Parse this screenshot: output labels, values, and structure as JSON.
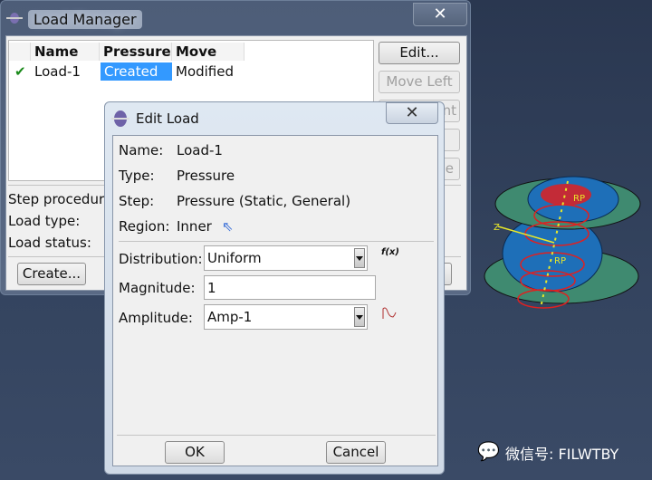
{
  "load_manager": {
    "title": "Load Manager",
    "columns": [
      "Name",
      "Pressure",
      "Move"
    ],
    "rows": [
      {
        "status": "check-icon",
        "name": "Load-1",
        "pressure": "Created",
        "move": "Modified"
      }
    ],
    "buttons": {
      "edit": "Edit...",
      "move_left": "Move Left",
      "move_right_partial": "nt",
      "partial_e": "e",
      "create": "Create..."
    },
    "labels": {
      "step_procedure": "Step procedur",
      "load_type": "Load type:",
      "load_status": "Load status:"
    }
  },
  "edit_load": {
    "title": "Edit Load",
    "name_label": "Name:",
    "name_value": "Load-1",
    "type_label": "Type:",
    "type_value": "Pressure",
    "step_label": "Step:",
    "step_value": "Pressure (Static, General)",
    "region_label": "Region:",
    "region_value": "Inner",
    "distribution_label": "Distribution:",
    "distribution_value": "Uniform",
    "fx_label": "f(x)",
    "magnitude_label": "Magnitude:",
    "magnitude_value": "1",
    "amplitude_label": "Amplitude:",
    "amplitude_value": "Amp-1",
    "ok": "OK",
    "cancel": "Cancel"
  },
  "viewport": {
    "rp_label_1": "RP",
    "rp_label_2": "RP",
    "axis_label": "Z"
  },
  "watermark": "微信号: FILWTBY",
  "colors": {
    "selection": "#3399ff",
    "check": "#1a8a1a",
    "part_blue": "#1e6fb8",
    "part_green": "#3f8a70",
    "load_red": "#e02020",
    "arrow_orange": "#ff7a1a"
  }
}
